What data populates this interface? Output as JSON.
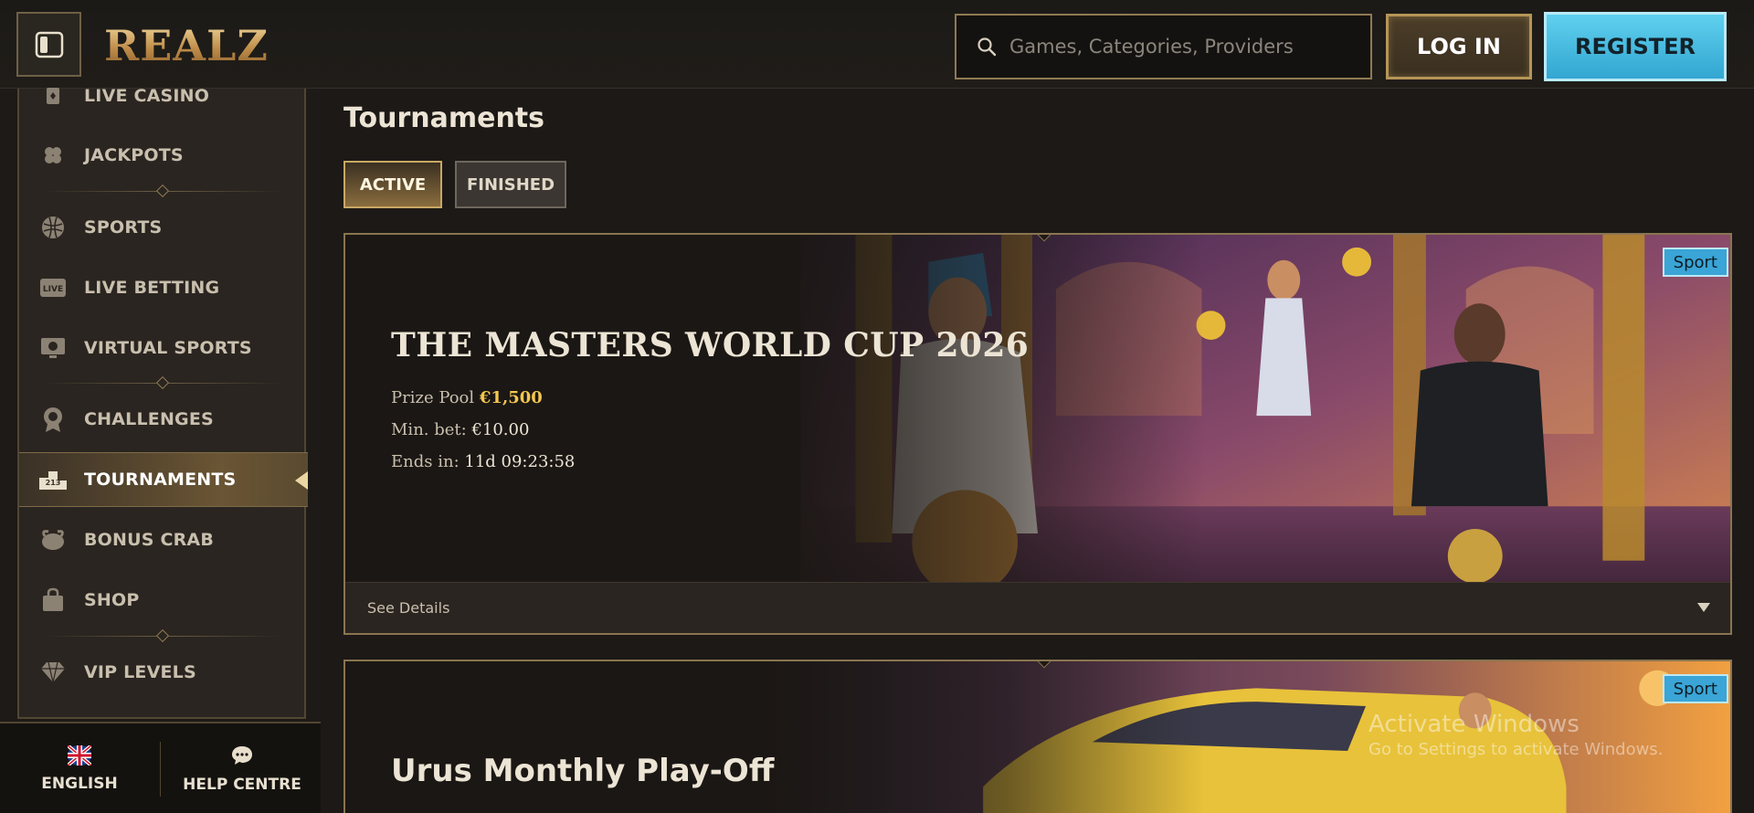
{
  "header": {
    "logo_text": "REALZ",
    "search_placeholder": "Games, Categories, Providers",
    "login_label": "LOG IN",
    "register_label": "REGISTER"
  },
  "sidebar": {
    "items": [
      {
        "label": "LIVE CASINO",
        "icon": "live-casino-icon"
      },
      {
        "label": "JACKPOTS",
        "icon": "clover-icon"
      },
      {
        "label": "SPORTS",
        "icon": "sports-ball-icon"
      },
      {
        "label": "LIVE BETTING",
        "icon": "live-badge-icon",
        "icon_text": "LIVE"
      },
      {
        "label": "VIRTUAL SPORTS",
        "icon": "virtual-sports-icon"
      },
      {
        "label": "CHALLENGES",
        "icon": "medal-icon"
      },
      {
        "label": "TOURNAMENTS",
        "icon": "podium-icon",
        "active": true,
        "icon_text": "213"
      },
      {
        "label": "BONUS CRAB",
        "icon": "crab-icon"
      },
      {
        "label": "SHOP",
        "icon": "shop-bag-icon"
      },
      {
        "label": "VIP LEVELS",
        "icon": "diamond-icon"
      }
    ],
    "footer": {
      "language_label": "ENGLISH",
      "help_label": "HELP CENTRE"
    }
  },
  "main": {
    "page_title": "Tournaments",
    "tabs": [
      {
        "label": "ACTIVE",
        "active": true
      },
      {
        "label": "FINISHED",
        "active": false
      }
    ],
    "cards": [
      {
        "badge": "Sport",
        "title": "THE MASTERS WORLD CUP 2026",
        "prize_pool_label": "Prize Pool",
        "prize_pool_value": "€1,500",
        "min_bet_label": "Min. bet:",
        "min_bet_value": "€10.00",
        "ends_in_label": "Ends in:",
        "ends_in_value": "11d 09:23:58",
        "details_label": "See Details"
      },
      {
        "badge": "Sport",
        "title": "Urus Monthly Play-Off"
      }
    ]
  },
  "watermark": {
    "line1": "Activate Windows",
    "line2": "Go to Settings to activate Windows."
  },
  "colors": {
    "accent_gold": "#c8a864",
    "register_blue": "#3aa5d6",
    "prize_gold": "#f2c651",
    "background": "#1c1917"
  }
}
